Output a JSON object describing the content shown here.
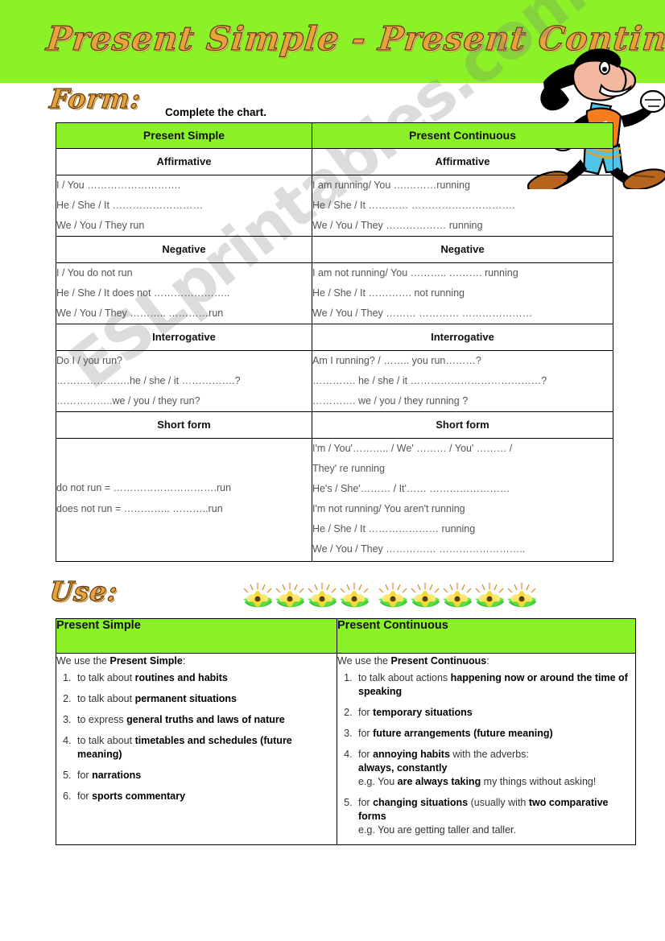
{
  "page": {
    "banner_color": "#8cf228",
    "title": "Present Simple - Present Continuous",
    "watermark": "ESLprintables.com"
  },
  "form_section": {
    "heading": "Form:",
    "instruction": "Complete the chart.",
    "columns": [
      "Present Simple",
      "Present Continuous"
    ],
    "groups": [
      {
        "label_left": "Affirmative",
        "label_right": "Affirmative",
        "left_lines": [
          "I / You ……………………….",
          "He / She / It ………………………",
          "We / You / They  run"
        ],
        "right_lines": [
          "I am running/ You ….………running",
          "He / She / It …………    ………………………….",
          "We / You / They ……………… running"
        ]
      },
      {
        "label_left": "Negative",
        "label_right": "Negative",
        "left_lines": [
          "I / You do not run",
          "He / She / It does not …………………..",
          "We / You / They  ………..  …………run"
        ],
        "right_lines": [
          "I am not running/ You ……….. ………. running",
          "He / She / It ………….    not running",
          "We / You / They ………  …………   …………………"
        ]
      },
      {
        "label_left": "Interrogative",
        "label_right": "Interrogative",
        "left_lines": [
          "Do I / you run?",
          "………………….he / she / it …………….?",
          "……………..we / you / they  run?"
        ],
        "right_lines": [
          "Am I running? / …….. you run………?",
          "…………. he / she / it  …………………………………?",
          "…………. we / you / they running ?"
        ]
      }
    ],
    "short_form": {
      "label_left": "Short form",
      "label_right": "Short form",
      "left_lines": [
        "do not run = ………………………….run",
        "does not run = ………….. ………..run"
      ],
      "right_lines": [
        "I'm / You'……….. / We' ……… / You' ……… /",
        "They' re running",
        "He's / She'……… / It'……   ……………………",
        "I'm not running/ You aren't running",
        "He / She / It ………………… running",
        "We / You / They ……………  …………………….."
      ]
    }
  },
  "use_section": {
    "heading": "Use:",
    "columns": [
      "Present Simple",
      "Present Continuous"
    ],
    "left": {
      "intro_prefix": "We use the ",
      "intro_bold": "Present Simple",
      "intro_suffix": ":",
      "items": [
        {
          "pre": "to talk about ",
          "bold": "routines and habits",
          "post": ""
        },
        {
          "pre": "to talk about ",
          "bold": "permanent situations",
          "post": ""
        },
        {
          "pre": "to express ",
          "bold": "general truths and laws of nature",
          "post": ""
        },
        {
          "pre": "to talk about ",
          "bold": "timetables and schedules (future meaning)",
          "post": ""
        },
        {
          "pre": "for ",
          "bold": "narrations",
          "post": ""
        },
        {
          "pre": "for ",
          "bold": "sports commentary",
          "post": ""
        }
      ]
    },
    "right": {
      "intro_prefix": "We use the ",
      "intro_bold": "Present Continuous",
      "intro_suffix": ":",
      "items": [
        {
          "pre": "to talk about actions ",
          "bold": "happening now or around the time of speaking",
          "post": "",
          "eg": ""
        },
        {
          "pre": "for ",
          "bold": "temporary situations",
          "post": "",
          "eg": ""
        },
        {
          "pre": "for ",
          "bold": "future arrangements (future meaning)",
          "post": "",
          "eg": ""
        },
        {
          "pre": "for ",
          "bold": "annoying habits",
          "post": " with the adverbs:",
          "bold2": "always, constantly",
          "eg_pre": "e.g. You ",
          "eg_bold": "are always taking",
          "eg_post": " my things without asking!"
        },
        {
          "pre": "for ",
          "bold": "changing situations",
          "post": " (usually with ",
          "bold2": "two comparative forms",
          "eg_pre": "e.g. You are getting taller and taller.",
          "eg_bold": "",
          "eg_post": ""
        }
      ]
    }
  }
}
